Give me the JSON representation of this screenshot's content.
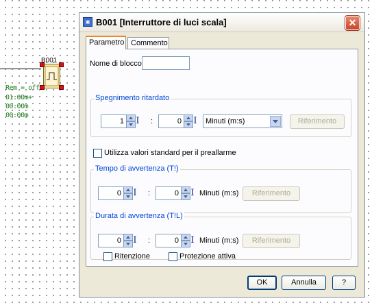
{
  "canvas": {
    "block": {
      "name": "B001",
      "params": [
        "Rem = off",
        "01:00m+",
        "00:00m",
        "00:00m"
      ]
    }
  },
  "dialog": {
    "title": "B001 [Interruttore di luci scala]",
    "close_glyph": "✕",
    "tabs": [
      "Parametro",
      "Commento"
    ],
    "block_name": {
      "label": "Nome di blocco",
      "value": ""
    },
    "off_delay": {
      "title": "Spegnimento ritardato",
      "value_a": "1",
      "value_b": "0",
      "separator": ":",
      "unit_selected": "Minuti (m:s)",
      "reference_button": "Riferimento"
    },
    "use_defaults": {
      "label": "Utilizza valori standard per il preallarme",
      "checked": false
    },
    "warning_time": {
      "title": "Tempo di avvertenza (T!)",
      "value_a": "0",
      "value_b": "0",
      "separator": ":",
      "unit": "Minuti (m:s)",
      "reference_button": "Riferimento"
    },
    "warning_duration": {
      "title": "Durata di avvertenza (T!L)",
      "value_a": "0",
      "value_b": "0",
      "separator": ":",
      "unit": "Minuti (m:s)",
      "reference_button": "Riferimento"
    },
    "retention": {
      "label": "Ritenzione",
      "checked": false
    },
    "protection": {
      "label": "Protezione attiva",
      "checked": false
    },
    "buttons": {
      "ok": "OK",
      "cancel": "Annulla",
      "help": "?"
    }
  },
  "icons": {
    "title": "block-app-icon",
    "spin": "spin-arrows-icon",
    "ibeam": "text-cursor-icon"
  }
}
